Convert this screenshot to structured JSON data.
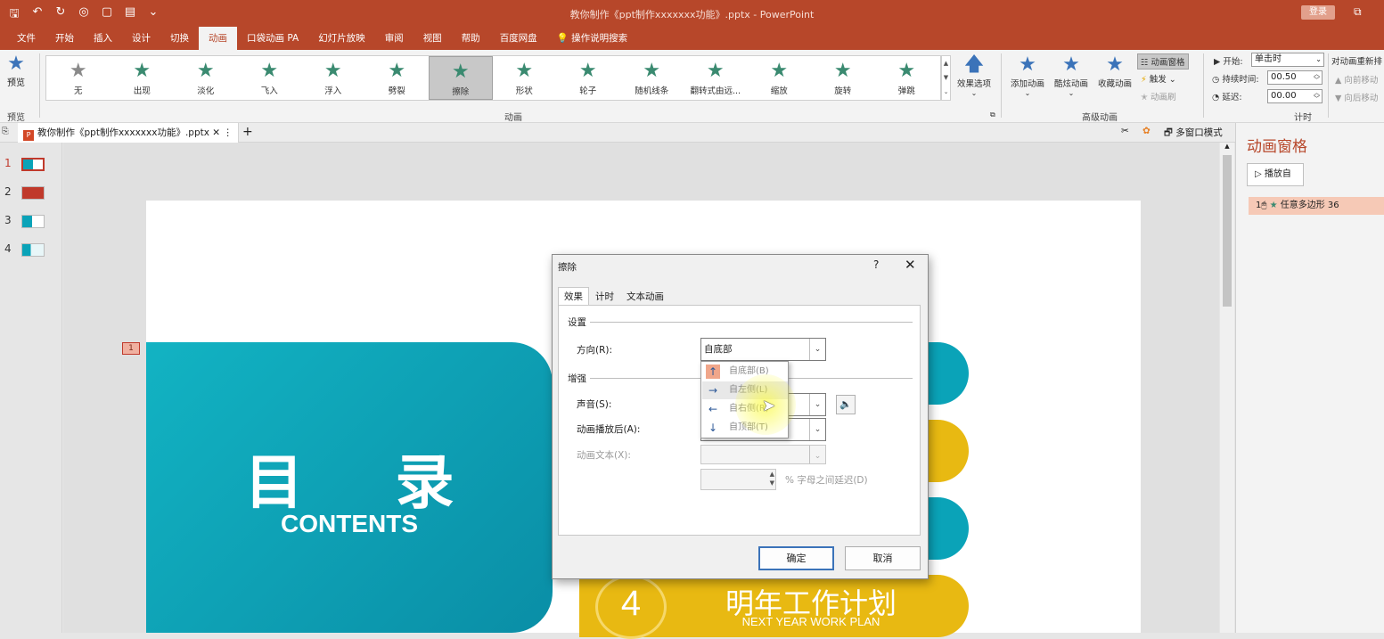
{
  "window": {
    "title": "教你制作《ppt制作xxxxxxx功能》.pptx - PowerPoint",
    "login": "登录"
  },
  "menu": [
    "文件",
    "开始",
    "插入",
    "设计",
    "切换",
    "动画",
    "口袋动画 PA",
    "幻灯片放映",
    "审阅",
    "视图",
    "帮助",
    "百度网盘",
    "操作说明搜索"
  ],
  "ribbon": {
    "preview": "预览",
    "preview_group": "预览",
    "gallery": [
      {
        "label": "无",
        "state": "dim"
      },
      {
        "label": "出现"
      },
      {
        "label": "淡化"
      },
      {
        "label": "飞入"
      },
      {
        "label": "浮入"
      },
      {
        "label": "劈裂"
      },
      {
        "label": "擦除",
        "state": "selected"
      },
      {
        "label": "形状"
      },
      {
        "label": "轮子"
      },
      {
        "label": "随机线条"
      },
      {
        "label": "翻转式由远..."
      },
      {
        "label": "缩放"
      },
      {
        "label": "旋转"
      },
      {
        "label": "弹跳"
      }
    ],
    "gallery_group": "动画",
    "effect_options": "效果选项",
    "add_anim": "添加动画",
    "cool_anim": "酷炫动画",
    "fav_anim": "收藏动画",
    "adv_group": "高级动画",
    "anim_pane": "动画窗格",
    "trigger": "触发",
    "anim_brush": "动画刷",
    "start_label": "开始:",
    "start_value": "单击时",
    "duration_label": "持续时间:",
    "duration_value": "00.50",
    "delay_label": "延迟:",
    "delay_value": "00.00",
    "timing_group": "计时",
    "reorder": "对动画重新排",
    "move_earlier": "向前移动",
    "move_later": "向后移动"
  },
  "doctab": {
    "name": "教你制作《ppt制作xxxxxxx功能》.pptx",
    "multiwin": "多窗口模式"
  },
  "thumbs": [
    "1",
    "2",
    "3",
    "4"
  ],
  "slide": {
    "title": "目 录",
    "subtitle": "CONTENTS",
    "tag": "1",
    "item4_num": "4",
    "item4_title": "明年工作计划",
    "item4_sub": "NEXT YEAR WORK PLAN"
  },
  "pane": {
    "title": "动画窗格",
    "play": "播放自",
    "item": "任意多边形 36",
    "item_num": "1"
  },
  "dialog": {
    "title": "擦除",
    "help": "?",
    "tabs": [
      "效果",
      "计时",
      "文本动画"
    ],
    "settings": "设置",
    "direction_label": "方向(R):",
    "direction_value": "自底部",
    "enhance": "增强",
    "sound_label": "声音(S):",
    "after_label": "动画播放后(A):",
    "text_label": "动画文本(X):",
    "delay_suffix": "% 字母之间延迟(D)",
    "ok": "确定",
    "cancel": "取消",
    "options": [
      {
        "label": "自底部(B)",
        "arrow": "↑"
      },
      {
        "label": "自左侧(L)",
        "arrow": "→"
      },
      {
        "label": "自右侧(R)",
        "arrow": "←"
      },
      {
        "label": "自顶部(T)",
        "arrow": "↓"
      }
    ]
  },
  "colors": {
    "brand": "#b7472a",
    "teal": "#0aa3b8",
    "yellow": "#e8b912",
    "star": "#3a8a70"
  }
}
